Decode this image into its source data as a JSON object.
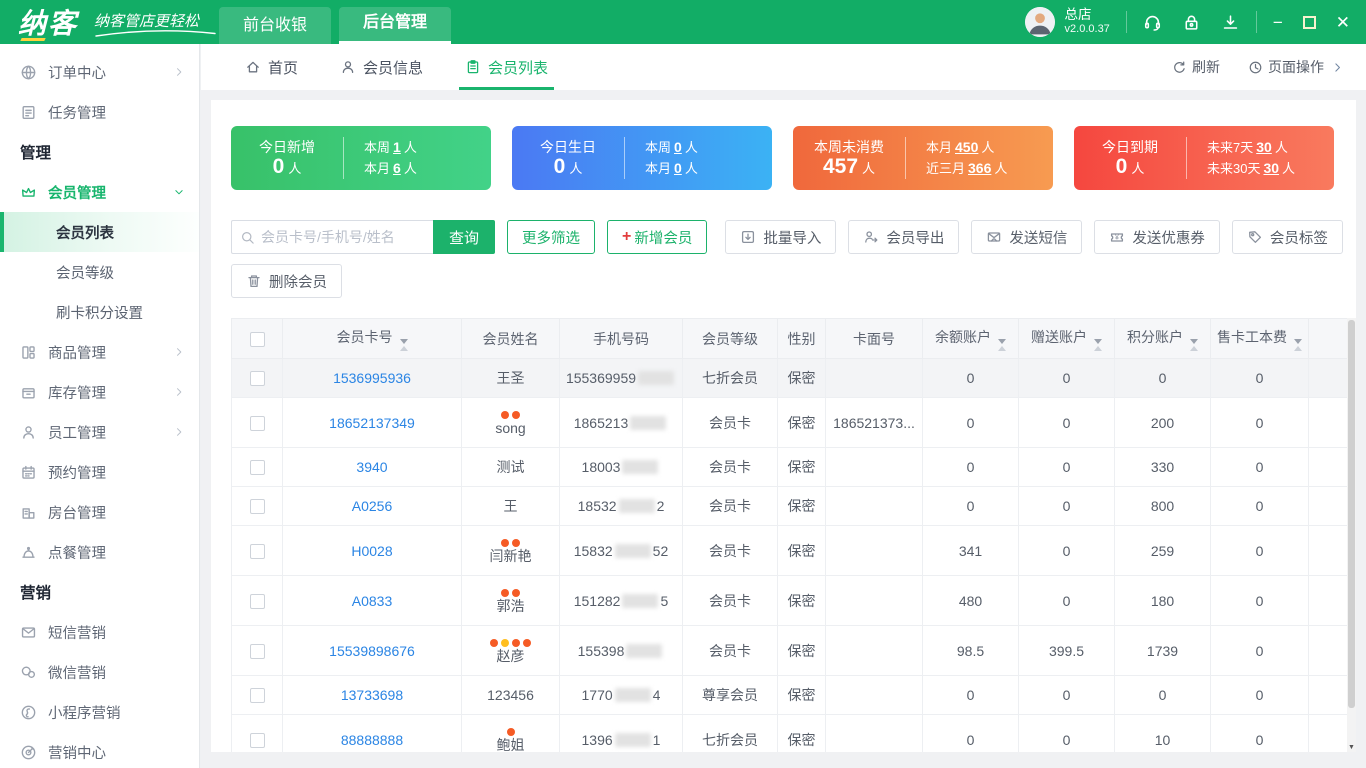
{
  "header": {
    "brand": "纳客",
    "slogan": "纳客管店更轻松",
    "nav_tabs": [
      {
        "name": "frontend-cashier",
        "label": "前台收银",
        "active": false
      },
      {
        "name": "backend-manage",
        "label": "后台管理",
        "active": true
      }
    ],
    "user": {
      "store": "总店",
      "version": "v2.0.0.37"
    },
    "tool_icons": [
      {
        "icon": "support"
      },
      {
        "icon": "lock"
      },
      {
        "icon": "download"
      }
    ],
    "window_controls": [
      {
        "icon": "minimize"
      },
      {
        "icon": "maximize"
      },
      {
        "icon": "close"
      }
    ]
  },
  "sidebar": {
    "items": [
      {
        "type": "item",
        "name": "order-center",
        "label": "订单中心",
        "icon": "globe",
        "chevron": "right"
      },
      {
        "type": "item",
        "name": "task-manage",
        "label": "任务管理",
        "icon": "task"
      },
      {
        "type": "section",
        "name": "section-manage",
        "label": "管理"
      },
      {
        "type": "item",
        "name": "member-manage",
        "label": "会员管理",
        "icon": "crown",
        "chevron": "down",
        "active_group": true
      },
      {
        "type": "subitem",
        "name": "member-list",
        "label": "会员列表",
        "active": true
      },
      {
        "type": "subitem",
        "name": "member-level",
        "label": "会员等级"
      },
      {
        "type": "subitem",
        "name": "card-points-setting",
        "label": "刷卡积分设置"
      },
      {
        "type": "item",
        "name": "goods-manage",
        "label": "商品管理",
        "icon": "goods",
        "chevron": "right"
      },
      {
        "type": "item",
        "name": "inventory-manage",
        "label": "库存管理",
        "icon": "inventory",
        "chevron": "right"
      },
      {
        "type": "item",
        "name": "staff-manage",
        "label": "员工管理",
        "icon": "staff",
        "chevron": "right"
      },
      {
        "type": "item",
        "name": "booking-manage",
        "label": "预约管理",
        "icon": "calendar"
      },
      {
        "type": "item",
        "name": "room-manage",
        "label": "房台管理",
        "icon": "room"
      },
      {
        "type": "item",
        "name": "ordering-manage",
        "label": "点餐管理",
        "icon": "bell"
      },
      {
        "type": "section",
        "name": "section-marketing",
        "label": "营销"
      },
      {
        "type": "item",
        "name": "sms-marketing",
        "label": "短信营销",
        "icon": "mail"
      },
      {
        "type": "item",
        "name": "wechat-marketing",
        "label": "微信营销",
        "icon": "wechat"
      },
      {
        "type": "item",
        "name": "miniprogram-marketing",
        "label": "小程序营销",
        "icon": "mini"
      },
      {
        "type": "item",
        "name": "marketing-center",
        "label": "营销中心",
        "icon": "target"
      }
    ]
  },
  "tabbar": {
    "tabs": [
      {
        "name": "home",
        "icon": "home",
        "label": "首页",
        "active": false
      },
      {
        "name": "member-info",
        "icon": "person",
        "label": "会员信息",
        "active": false
      },
      {
        "name": "member-list",
        "icon": "clipboard",
        "label": "会员列表",
        "active": true
      }
    ],
    "refresh": "刷新",
    "page_ops": "页面操作"
  },
  "cards": [
    {
      "name": "today-new",
      "title": "今日新增",
      "value": "0",
      "unit": "人",
      "g1": "#38c169",
      "g2": "#42d288",
      "stats": [
        {
          "label": "本周",
          "value": "1",
          "unit": "人"
        },
        {
          "label": "本月",
          "value": "6",
          "unit": "人"
        }
      ]
    },
    {
      "name": "today-birthday",
      "title": "今日生日",
      "value": "0",
      "unit": "人",
      "g1": "#4b79f3",
      "g2": "#3bb2f4",
      "stats": [
        {
          "label": "本周",
          "value": "0",
          "unit": "人"
        },
        {
          "label": "本月",
          "value": "0",
          "unit": "人"
        }
      ]
    },
    {
      "name": "week-no-consume",
      "title": "本周未消费",
      "value": "457",
      "unit": "人",
      "g1": "#f0683c",
      "g2": "#f79b51",
      "stats": [
        {
          "label": "本月",
          "value": "450",
          "unit": "人"
        },
        {
          "label": "近三月",
          "value": "366",
          "unit": "人"
        }
      ]
    },
    {
      "name": "today-expire",
      "title": "今日到期",
      "value": "0",
      "unit": "人",
      "g1": "#f5473f",
      "g2": "#f97a5e",
      "stats": [
        {
          "label": "未来7天",
          "value": "30",
          "unit": "人"
        },
        {
          "label": "未来30天",
          "value": "30",
          "unit": "人"
        }
      ]
    }
  ],
  "toolbar": {
    "search_placeholder": "会员卡号/手机号/姓名",
    "search_button": "查询",
    "filter_button": "更多筛选",
    "add_member_button": "新增会员",
    "add_member_plus": "+",
    "gray_buttons": [
      {
        "name": "bulk-import",
        "icon": "import",
        "label": "批量导入"
      },
      {
        "name": "member-export",
        "icon": "export-user",
        "label": "会员导出"
      },
      {
        "name": "send-sms",
        "icon": "mail-send",
        "label": "发送短信"
      },
      {
        "name": "send-coupon",
        "icon": "coupon",
        "label": "发送优惠券"
      },
      {
        "name": "member-tag",
        "icon": "tag",
        "label": "会员标签"
      }
    ],
    "delete_button": {
      "name": "delete-member",
      "icon": "trash",
      "label": "删除会员"
    }
  },
  "table": {
    "columns": [
      {
        "key": "check",
        "label": "",
        "type": "checkbox"
      },
      {
        "key": "card",
        "label": "会员卡号",
        "sortable": true
      },
      {
        "key": "name",
        "label": "会员姓名"
      },
      {
        "key": "phone",
        "label": "手机号码"
      },
      {
        "key": "level",
        "label": "会员等级"
      },
      {
        "key": "gender",
        "label": "性别"
      },
      {
        "key": "face",
        "label": "卡面号"
      },
      {
        "key": "balance",
        "label": "余额账户",
        "sortable": true
      },
      {
        "key": "gift",
        "label": "赠送账户",
        "sortable": true
      },
      {
        "key": "points",
        "label": "积分账户",
        "sortable": true
      },
      {
        "key": "fee",
        "label": "售卡工本费",
        "sortable": true
      },
      {
        "key": "extra",
        "label": ""
      }
    ],
    "rows": [
      {
        "card": "1536995936",
        "dots": [],
        "name": "王圣",
        "phone_prefix": "155369959",
        "phone_suffix": "",
        "level": "七折会员",
        "gender": "保密",
        "face": "",
        "balance": "0",
        "gift": "0",
        "points": "0",
        "fee": "0",
        "shade": true
      },
      {
        "card": "18652137349",
        "dots": [
          "#f55b25",
          "#f55b25"
        ],
        "name": "song",
        "phone_prefix": "1865213",
        "phone_suffix": "",
        "level": "会员卡",
        "gender": "保密",
        "face": "186521373...",
        "balance": "0",
        "gift": "0",
        "points": "200",
        "fee": "0"
      },
      {
        "card": "3940",
        "dots": [],
        "name": "测试",
        "phone_prefix": "18003",
        "phone_suffix": "",
        "level": "会员卡",
        "gender": "保密",
        "face": "",
        "balance": "0",
        "gift": "0",
        "points": "330",
        "fee": "0"
      },
      {
        "card": "A0256",
        "dots": [],
        "name": "王",
        "phone_prefix": "18532",
        "phone_suffix": "2",
        "level": "会员卡",
        "gender": "保密",
        "face": "",
        "balance": "0",
        "gift": "0",
        "points": "800",
        "fee": "0"
      },
      {
        "card": "H0028",
        "dots": [
          "#f55b25",
          "#f55b25"
        ],
        "name": "闫新艳",
        "phone_prefix": "15832",
        "phone_suffix": "52",
        "level": "会员卡",
        "gender": "保密",
        "face": "",
        "balance": "341",
        "gift": "0",
        "points": "259",
        "fee": "0"
      },
      {
        "card": "A0833",
        "dots": [
          "#f55b25",
          "#f55b25"
        ],
        "name": "郭浩",
        "phone_prefix": "151282",
        "phone_suffix": "5",
        "level": "会员卡",
        "gender": "保密",
        "face": "",
        "balance": "480",
        "gift": "0",
        "points": "180",
        "fee": "0"
      },
      {
        "card": "15539898676",
        "dots": [
          "#f55b25",
          "#ffbe1f",
          "#f55b25",
          "#f55b25"
        ],
        "name": "赵彦",
        "phone_prefix": "155398",
        "phone_suffix": "",
        "level": "会员卡",
        "gender": "保密",
        "face": "",
        "balance": "98.5",
        "gift": "399.5",
        "points": "1739",
        "fee": "0"
      },
      {
        "card": "13733698",
        "dots": [],
        "name": "123456",
        "phone_prefix": "1770",
        "phone_suffix": "4",
        "level": "尊享会员",
        "gender": "保密",
        "face": "",
        "balance": "0",
        "gift": "0",
        "points": "0",
        "fee": "0"
      },
      {
        "card": "88888888",
        "dots": [
          "#f55b25"
        ],
        "name": "鲍姐",
        "phone_prefix": "1396",
        "phone_suffix": "1",
        "level": "七折会员",
        "gender": "保密",
        "face": "",
        "balance": "0",
        "gift": "0",
        "points": "10",
        "fee": "0"
      }
    ]
  }
}
